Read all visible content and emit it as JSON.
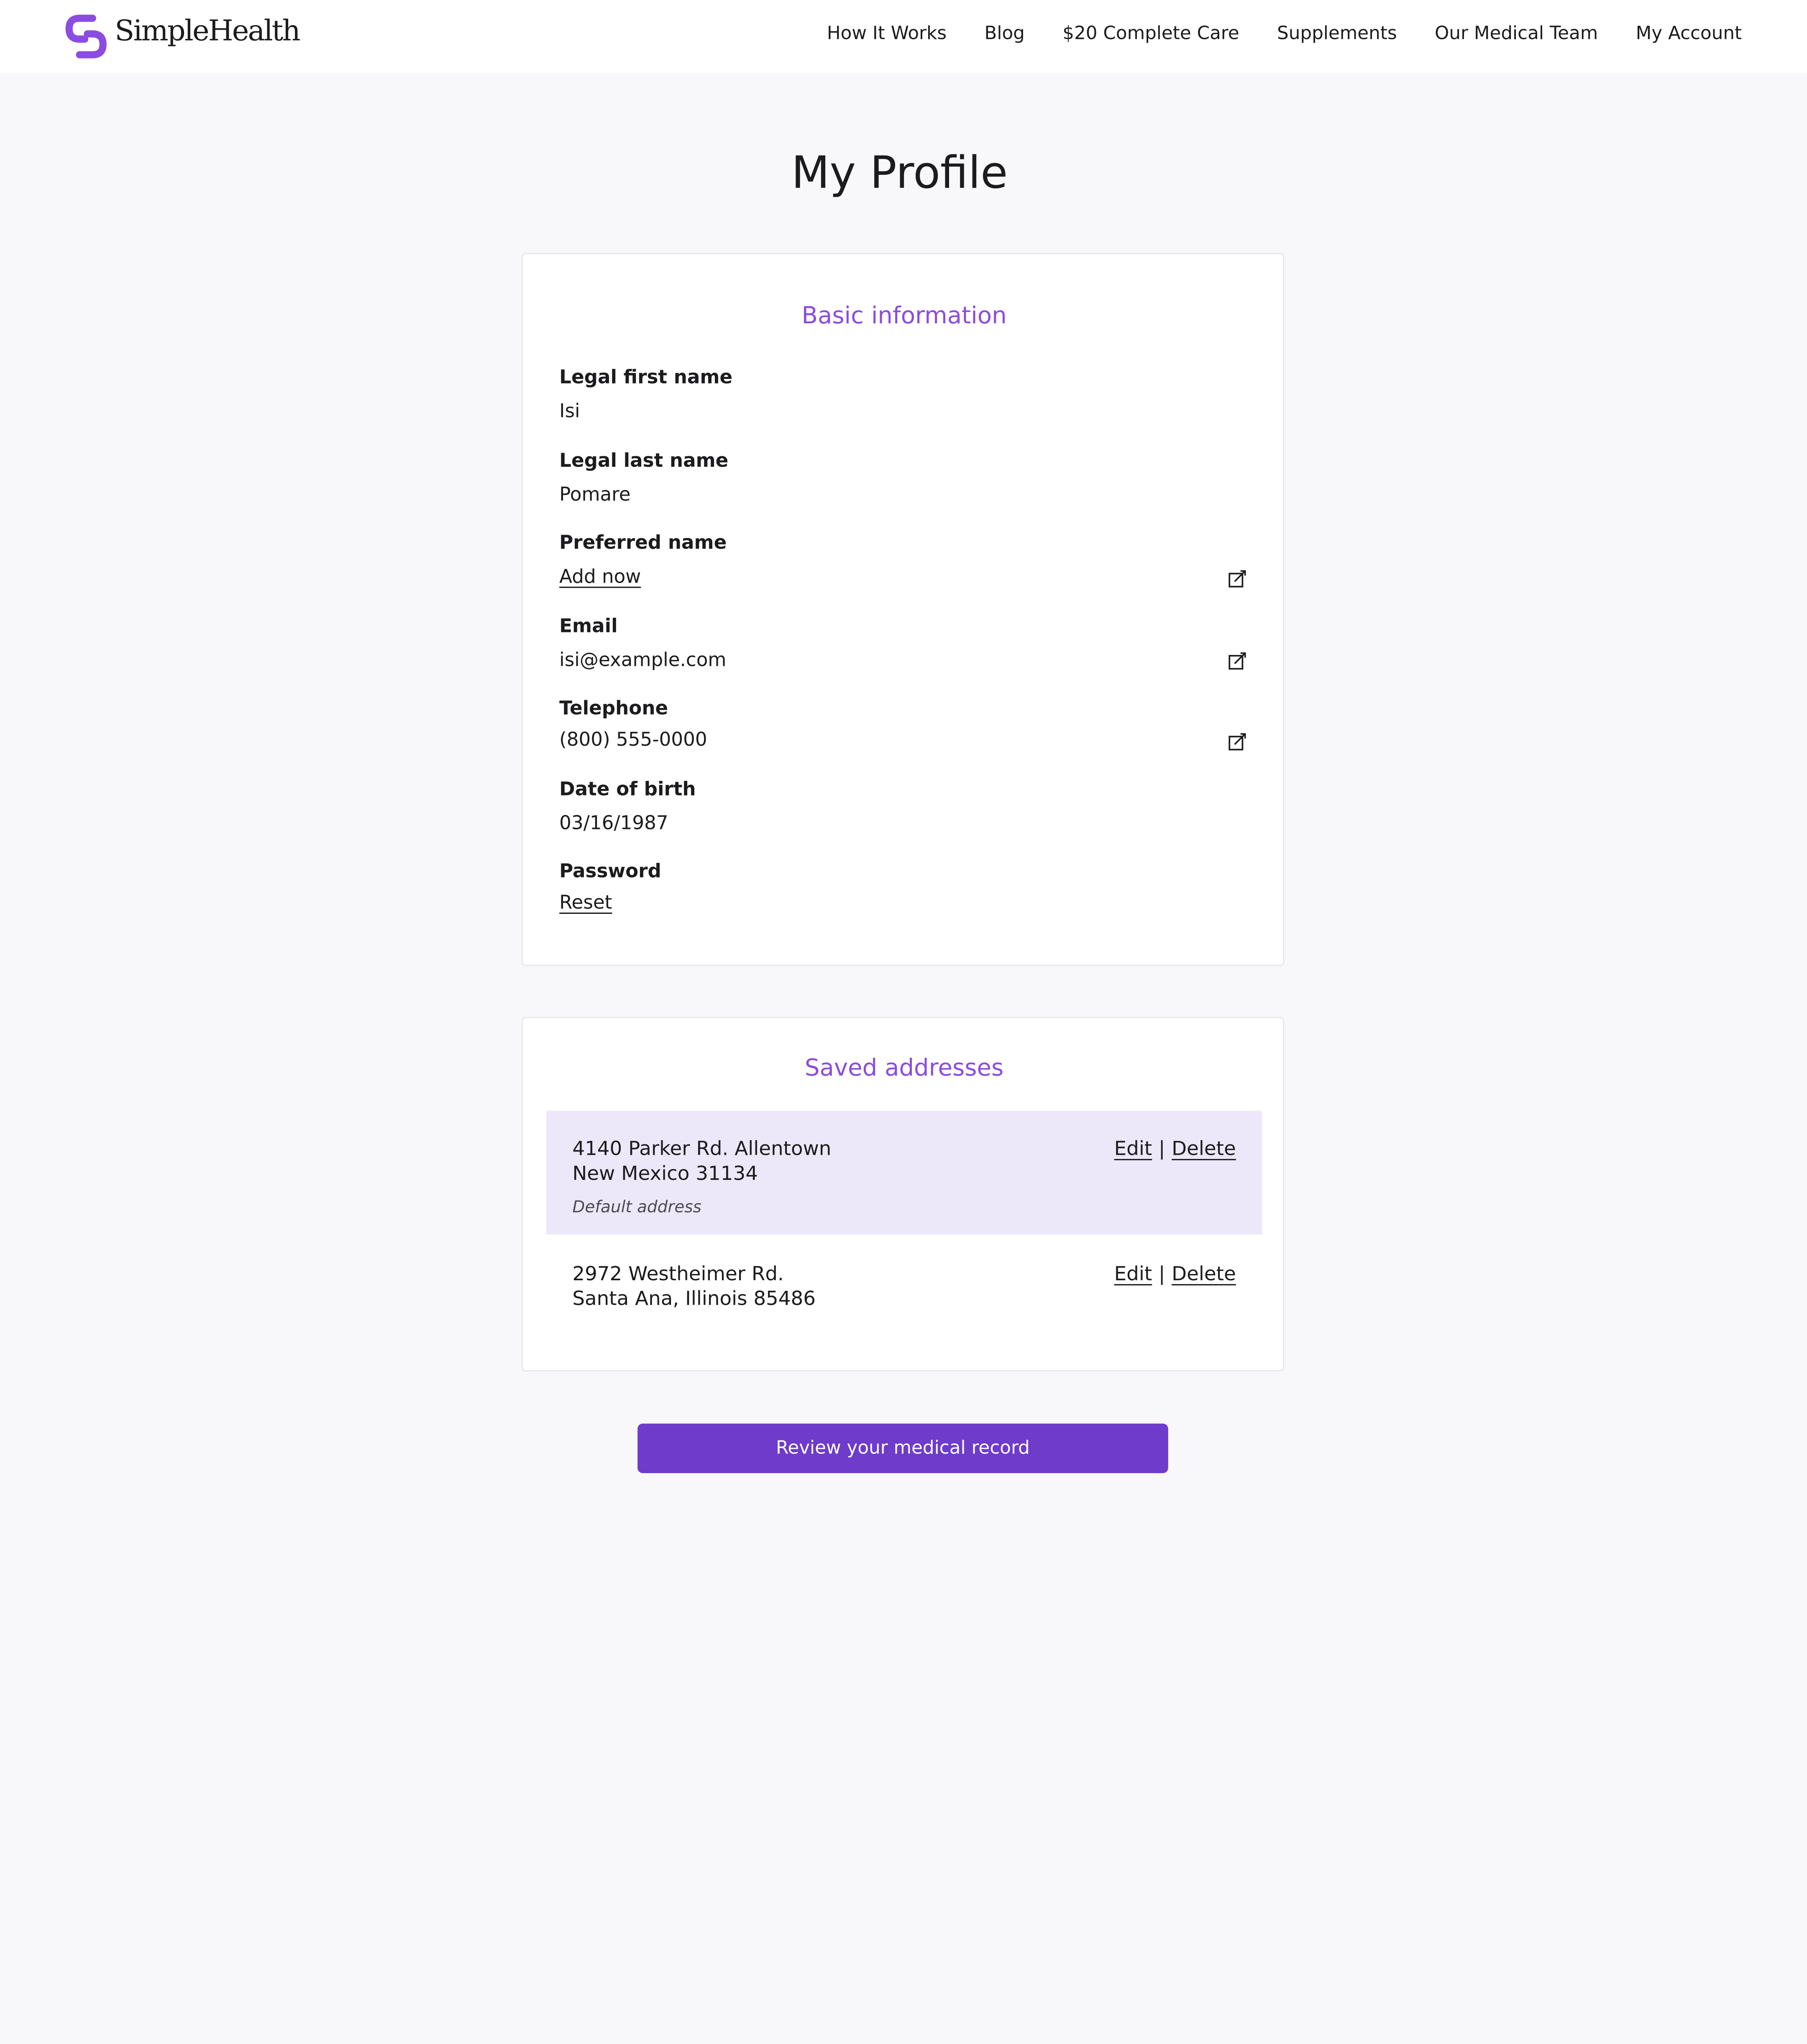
{
  "brand": {
    "name": "SimpleHealth",
    "accent_color": "#8b4ce0",
    "button_color": "#6e3bcb"
  },
  "nav": {
    "links": [
      "How It Works",
      "Blog",
      "$20 Complete Care",
      "Supplements",
      "Our Medical Team",
      "My Account"
    ]
  },
  "page": {
    "title": "My Profile"
  },
  "basic_info": {
    "title": "Basic information",
    "legal_first_name": {
      "label": "Legal first name",
      "value": "Isi"
    },
    "legal_last_name": {
      "label": "Legal last name",
      "value": "Pomare"
    },
    "preferred_name": {
      "label": "Preferred name",
      "value": "Add now",
      "icon": "edit-icon"
    },
    "email": {
      "label": "Email",
      "value": "isi@example.com",
      "icon": "edit-icon"
    },
    "telephone": {
      "label": "Telephone",
      "value": "(800) 555-0000",
      "icon": "edit-icon"
    },
    "date_of_birth": {
      "label": "Date of birth",
      "value": "03/16/1987"
    },
    "password": {
      "label": "Password",
      "value": "Reset"
    }
  },
  "addresses": {
    "title": "Saved addresses",
    "edit_label": "Edit",
    "separator": "|",
    "delete_label": "Delete",
    "items": [
      {
        "line1": "4140 Parker Rd. Allentown",
        "line2": "New Mexico 31134",
        "note": "Default address"
      },
      {
        "line1": "2972 Westheimer Rd.",
        "line2": "Santa Ana, Illinois 85486"
      }
    ]
  },
  "cta": {
    "label": "Review your medical record"
  }
}
